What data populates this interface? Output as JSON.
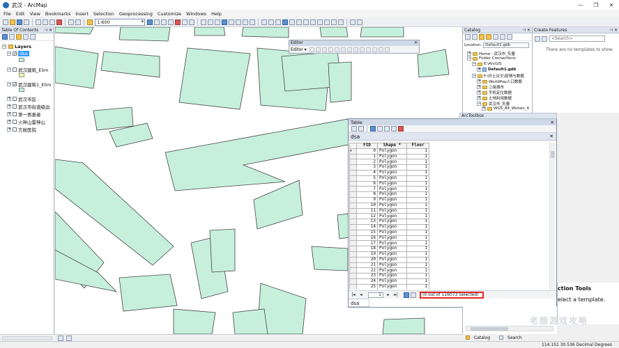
{
  "window": {
    "title": "武汉 - ArcMap",
    "minimize": "—",
    "restore": "❐",
    "close": "✕"
  },
  "menu": [
    "File",
    "Edit",
    "View",
    "Bookmarks",
    "Insert",
    "Selection",
    "Geoprocessing",
    "Customize",
    "Windows",
    "Help"
  ],
  "toolbar": {
    "scale": "1:600"
  },
  "toc": {
    "title": "Table Of Contents",
    "root": "Layers",
    "layers": [
      {
        "name": "dsa",
        "checked": true,
        "selected": true,
        "swatch": "green"
      },
      {
        "name": "武汉建筑_Elim",
        "checked": false,
        "swatch": "yellow"
      },
      {
        "name": "武汉建筑1_Elim",
        "checked": true,
        "swatch": "green"
      },
      {
        "name": "武汉市区",
        "checked": false
      },
      {
        "name": "武汉市街道级边",
        "checked": false
      },
      {
        "name": "第一例患者",
        "checked": false
      },
      {
        "name": "火神山雷神山",
        "checked": false
      },
      {
        "name": "方舱医院",
        "checked": false
      }
    ]
  },
  "editor": {
    "title": "Editor",
    "menu_label": "Editor ▾"
  },
  "table": {
    "title": "Table",
    "tab": "dsa",
    "columns": [
      "FID",
      "Shape *",
      "Floor"
    ],
    "rows": [
      [
        0,
        "Polygon",
        1
      ],
      [
        1,
        "Polygon",
        1
      ],
      [
        2,
        "Polygon",
        1
      ],
      [
        3,
        "Polygon",
        1
      ],
      [
        4,
        "Polygon",
        1
      ],
      [
        5,
        "Polygon",
        1
      ],
      [
        6,
        "Polygon",
        1
      ],
      [
        7,
        "Polygon",
        1
      ],
      [
        8,
        "Polygon",
        1
      ],
      [
        9,
        "Polygon",
        1
      ],
      [
        10,
        "Polygon",
        1
      ],
      [
        11,
        "Polygon",
        1
      ],
      [
        12,
        "Polygon",
        1
      ],
      [
        13,
        "Polygon",
        1
      ],
      [
        14,
        "Polygon",
        1
      ],
      [
        15,
        "Polygon",
        1
      ],
      [
        16,
        "Polygon",
        1
      ],
      [
        17,
        "Polygon",
        1
      ],
      [
        18,
        "Polygon",
        1
      ],
      [
        19,
        "Polygon",
        1
      ],
      [
        20,
        "Polygon",
        1
      ],
      [
        21,
        "Polygon",
        1
      ],
      [
        22,
        "Polygon",
        1
      ],
      [
        23,
        "Polygon",
        1
      ],
      [
        24,
        "Polygon",
        1
      ],
      [
        25,
        "Polygon",
        1
      ]
    ],
    "record": "1",
    "selection_status": "(0 out of 116073 Selected)",
    "bottom_tab": "dsa"
  },
  "catalog": {
    "title": "Catalog",
    "location_label": "Location:",
    "location": "Default1.gdb",
    "items": [
      {
        "text": "Home - 武汉市_矢量",
        "kind": "folder"
      },
      {
        "text": "Folder Connections",
        "kind": "folder"
      },
      {
        "text": "E:\\ArcGIS",
        "kind": "folder"
      },
      {
        "text": "Default1.gdb",
        "kind": "gdb"
      },
      {
        "text": "F:\\环土论文\\疫情与数据",
        "kind": "folder"
      },
      {
        "text": "WorldPop人口数据",
        "kind": "folder"
      },
      {
        "text": "二级城市",
        "kind": "folder"
      },
      {
        "text": "手机定位数据",
        "kind": "folder"
      },
      {
        "text": "土地利用数据",
        "kind": "folder"
      },
      {
        "text": "武汉市_矢量",
        "kind": "folder"
      },
      {
        "text": "WGS_84_Wuhan_4",
        "kind": "folder"
      }
    ]
  },
  "create_features": {
    "title": "Create Features",
    "search_placeholder": "<Search>",
    "message": "There are no templates to show."
  },
  "arctoolbox": {
    "title": "ArcToolbox"
  },
  "construction_tools": {
    "title": "ction Tools",
    "message": "elect a template."
  },
  "bottom_tabs": {
    "catalog": "Catalog",
    "search": "Search"
  },
  "status": {
    "coords": "114.151  30.536 Decimal Degrees"
  },
  "watermark": "老醋游戏攻略",
  "colors": {
    "polygon_fill": "#c7f0dc",
    "polygon_stroke": "#444444",
    "highlight": "#e3261f",
    "selection": "#3399ff"
  }
}
